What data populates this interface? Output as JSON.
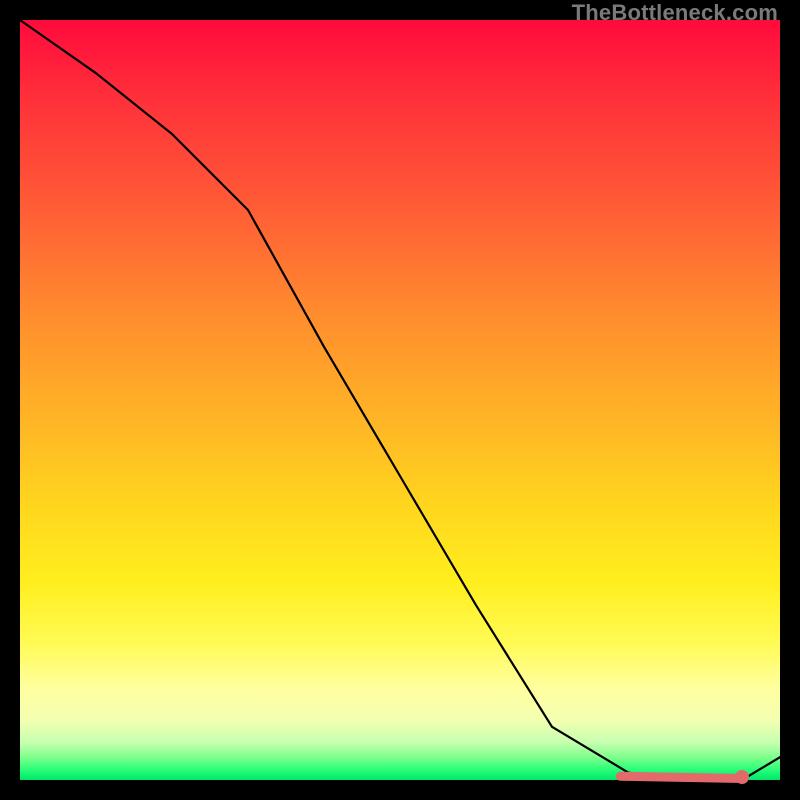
{
  "watermark": "TheBottleneck.com",
  "colors": {
    "curve": "#000000",
    "highlight": "#e36a6a"
  },
  "chart_data": {
    "type": "line",
    "title": "",
    "xlabel": "",
    "ylabel": "",
    "xlim": [
      0,
      100
    ],
    "ylim": [
      0,
      100
    ],
    "x": [
      0,
      10,
      20,
      30,
      40,
      50,
      60,
      70,
      80,
      85,
      90,
      95,
      100
    ],
    "values": [
      100,
      93,
      85,
      75,
      57,
      40,
      23,
      7,
      1,
      0,
      0,
      0,
      3
    ],
    "highlight_range_x": [
      79,
      95
    ],
    "highlight_end_x": 95,
    "grid": false,
    "legend": false
  }
}
